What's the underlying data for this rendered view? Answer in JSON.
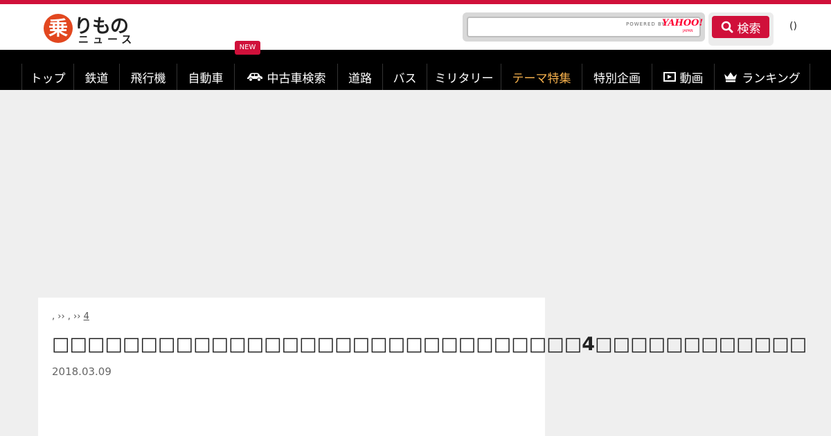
{
  "header": {
    "logo_mark": "乗",
    "logo_top": "りもの",
    "logo_bottom": "ニュース",
    "search": {
      "placeholder": "",
      "powered_by": "POWERED BY",
      "yahoo": "YAHOO!",
      "yahoo_sub": "JAPAN",
      "button_label": "検索"
    },
    "paren": "()"
  },
  "nav": {
    "new_badge": "NEW",
    "items": [
      {
        "label": "トップ",
        "icon": null
      },
      {
        "label": "鉄道",
        "icon": null
      },
      {
        "label": "飛行機",
        "icon": null
      },
      {
        "label": "自動車",
        "icon": null
      },
      {
        "label": "中古車検索",
        "icon": "car-icon"
      },
      {
        "label": "道路",
        "icon": null
      },
      {
        "label": "バス",
        "icon": null
      },
      {
        "label": "ミリタリー",
        "icon": null
      },
      {
        "label": "テーマ特集",
        "icon": null
      },
      {
        "label": "特別企画",
        "icon": null
      },
      {
        "label": "動画",
        "icon": "video-icon"
      },
      {
        "label": "ランキング",
        "icon": "crown-icon"
      }
    ],
    "active_color": "#f5b04c"
  },
  "article": {
    "breadcrumb": [
      {
        "text": ", ›› , ›› ",
        "link": false
      },
      {
        "text": "4",
        "link": true
      }
    ],
    "title": "□□□□□□□□□□□□□□□□□□□□□□□□□□□□□□4□□□□□□□□□□□□",
    "date": "2018.03.09"
  },
  "colors": {
    "brand_red": "#d0103a",
    "logo_orange": "#e2471f"
  }
}
